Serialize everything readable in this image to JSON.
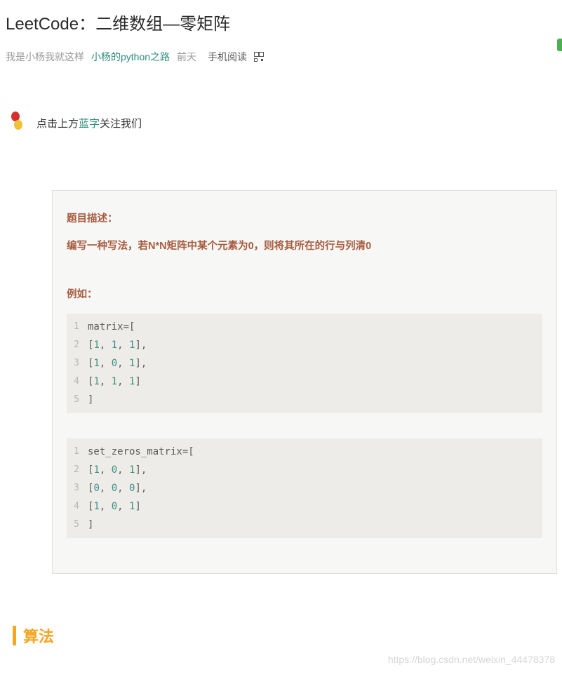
{
  "title": "LeetCode：二维数组—零矩阵",
  "meta": {
    "author": "我是小杨我就这样",
    "source": "小杨的python之路",
    "time": "前天",
    "mobile_read": "手机阅读"
  },
  "follow": {
    "prefix": "点击上方",
    "blue": "蓝字",
    "suffix": "关注我们"
  },
  "desc": {
    "label": "题目描述：",
    "text": "编写一种写法，若N*N矩阵中某个元素为0，则将其所在的行与列清0"
  },
  "example_label": "例如：",
  "code1": [
    {
      "n": "1",
      "seg": [
        {
          "t": "matrix=["
        }
      ]
    },
    {
      "n": "2",
      "seg": [
        {
          "t": "["
        },
        {
          "t": "1",
          "c": "n"
        },
        {
          "t": ", "
        },
        {
          "t": "1",
          "c": "n"
        },
        {
          "t": ", "
        },
        {
          "t": "1",
          "c": "n"
        },
        {
          "t": "],"
        }
      ]
    },
    {
      "n": "3",
      "seg": [
        {
          "t": "["
        },
        {
          "t": "1",
          "c": "n"
        },
        {
          "t": ", "
        },
        {
          "t": "0",
          "c": "n"
        },
        {
          "t": ", "
        },
        {
          "t": "1",
          "c": "n"
        },
        {
          "t": "],"
        }
      ]
    },
    {
      "n": "4",
      "seg": [
        {
          "t": "["
        },
        {
          "t": "1",
          "c": "n"
        },
        {
          "t": ", "
        },
        {
          "t": "1",
          "c": "n"
        },
        {
          "t": ", "
        },
        {
          "t": "1",
          "c": "n"
        },
        {
          "t": "]"
        }
      ]
    },
    {
      "n": "5",
      "seg": [
        {
          "t": "]"
        }
      ]
    }
  ],
  "code2": [
    {
      "n": "1",
      "seg": [
        {
          "t": "set_zeros_matrix=["
        }
      ]
    },
    {
      "n": "2",
      "seg": [
        {
          "t": "["
        },
        {
          "t": "1",
          "c": "n"
        },
        {
          "t": ", "
        },
        {
          "t": "0",
          "c": "n"
        },
        {
          "t": ", "
        },
        {
          "t": "1",
          "c": "n"
        },
        {
          "t": "],"
        }
      ]
    },
    {
      "n": "3",
      "seg": [
        {
          "t": "["
        },
        {
          "t": "0",
          "c": "n"
        },
        {
          "t": ", "
        },
        {
          "t": "0",
          "c": "n"
        },
        {
          "t": ", "
        },
        {
          "t": "0",
          "c": "n"
        },
        {
          "t": "],"
        }
      ]
    },
    {
      "n": "4",
      "seg": [
        {
          "t": "["
        },
        {
          "t": "1",
          "c": "n"
        },
        {
          "t": ", "
        },
        {
          "t": "0",
          "c": "n"
        },
        {
          "t": ", "
        },
        {
          "t": "1",
          "c": "n"
        },
        {
          "t": "]"
        }
      ]
    },
    {
      "n": "5",
      "seg": [
        {
          "t": "]"
        }
      ]
    }
  ],
  "algo_heading": "算法",
  "watermark": "https://blog.csdn.net/weixin_44478378"
}
